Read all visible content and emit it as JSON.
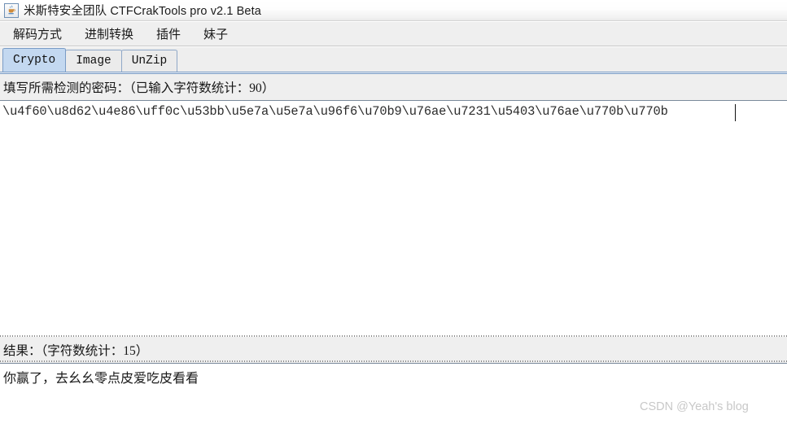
{
  "window": {
    "title": "米斯特安全团队 CTFCrakTools pro v2.1 Beta",
    "icon": "java-coffee-cup-icon"
  },
  "menubar": {
    "items": [
      {
        "label": "解码方式"
      },
      {
        "label": "进制转换"
      },
      {
        "label": "插件"
      },
      {
        "label": "妹子"
      }
    ]
  },
  "tabs": {
    "selected": "Crypto",
    "items": [
      {
        "label": "Crypto"
      },
      {
        "label": "Image"
      },
      {
        "label": "UnZip"
      }
    ]
  },
  "input_panel": {
    "label": "填写所需检测的密码：（已输入字符数统计：90）",
    "value": "\\u4f60\\u8d62\\u4e86\\uff0c\\u53bb\\u5e7a\\u5e7a\\u96f6\\u70b9\\u76ae\\u7231\\u5403\\u76ae\\u770b\\u770b",
    "placeholder": "",
    "char_count": 90
  },
  "result_panel": {
    "label": "结果：（字符数统计：15）",
    "value": "你赢了，去幺幺零点皮爱吃皮看看",
    "char_count": 15
  },
  "watermark": {
    "text": "CSDN @Yeah's blog"
  },
  "colors": {
    "tab_selected": "#c3d8f0",
    "tab_border": "#7a9cc6",
    "panel_bg": "#efefef",
    "text_bg": "#ffffff",
    "watermark": "#c8c8c8"
  }
}
